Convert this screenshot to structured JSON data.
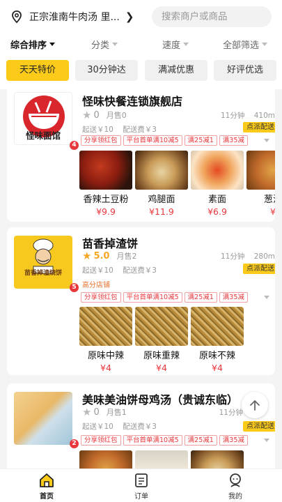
{
  "header": {
    "location": "正宗淮南牛肉汤 里...",
    "search_placeholder": "搜索商户或商品"
  },
  "sorts": [
    {
      "label": "综合排序",
      "active": true
    },
    {
      "label": "分类"
    },
    {
      "label": "速度"
    },
    {
      "label": "全部筛选"
    }
  ],
  "chips": [
    {
      "label": "天天特价",
      "active": true
    },
    {
      "label": "30分钟达"
    },
    {
      "label": "满减优惠"
    },
    {
      "label": "好评优选"
    }
  ],
  "shops": [
    {
      "name": "怪味快餐连锁旗舰店",
      "logo_text": "怪味面馆",
      "badge": "4",
      "score": "0",
      "sold": "月售0",
      "time": "11分钟",
      "distance": "410m",
      "min_order": "起送￥10",
      "delivery_fee": "配送费￥3",
      "delivery_tag": "点派配送",
      "feature_tag": "",
      "promos": [
        "分享领红包",
        "平台首单满10减5",
        "满25减1",
        "满35减"
      ],
      "dishes": [
        {
          "name": "香辣土豆粉",
          "price": "¥9.9"
        },
        {
          "name": "鸡腿面",
          "price": "¥11.9"
        },
        {
          "name": "素面",
          "price": "¥6.9"
        },
        {
          "name": "葱油",
          "price": "¥"
        }
      ]
    },
    {
      "name": "苗香掉渣饼",
      "logo_text": "苗香掉渣烧饼",
      "badge": "5",
      "score": "5.0",
      "sold": "月售2",
      "time": "11分钟",
      "distance": "280m",
      "min_order": "起送￥10",
      "delivery_fee": "配送费￥3",
      "delivery_tag": "点派配送",
      "feature_tag": "高分店铺",
      "promos": [
        "分享领红包",
        "平台首单满10减5",
        "满25减1",
        "满35减"
      ],
      "dishes": [
        {
          "name": "原味中辣",
          "price": "¥4"
        },
        {
          "name": "原味重辣",
          "price": "¥4"
        },
        {
          "name": "原味不辣",
          "price": "¥4"
        }
      ]
    },
    {
      "name": "美味美油饼母鸡汤（贵诚东临）",
      "badge": "2",
      "score": "0",
      "sold": "月售1",
      "time": "11分钟",
      "distance": "",
      "min_order": "起送￥10",
      "delivery_fee": "配送费￥3",
      "delivery_tag": "点派配送",
      "feature_tag": "",
      "promos": [
        "分享领红包",
        "平台首单满10减5",
        "满25减1",
        "满35减"
      ]
    }
  ],
  "nav": [
    {
      "label": "首页",
      "icon": "home-icon",
      "active": true
    },
    {
      "label": "订单",
      "icon": "order-icon"
    },
    {
      "label": "我的",
      "icon": "profile-icon"
    }
  ],
  "colors": {
    "accent": "#fccb1a",
    "price": "#e8383d",
    "star": "#f5a623"
  }
}
